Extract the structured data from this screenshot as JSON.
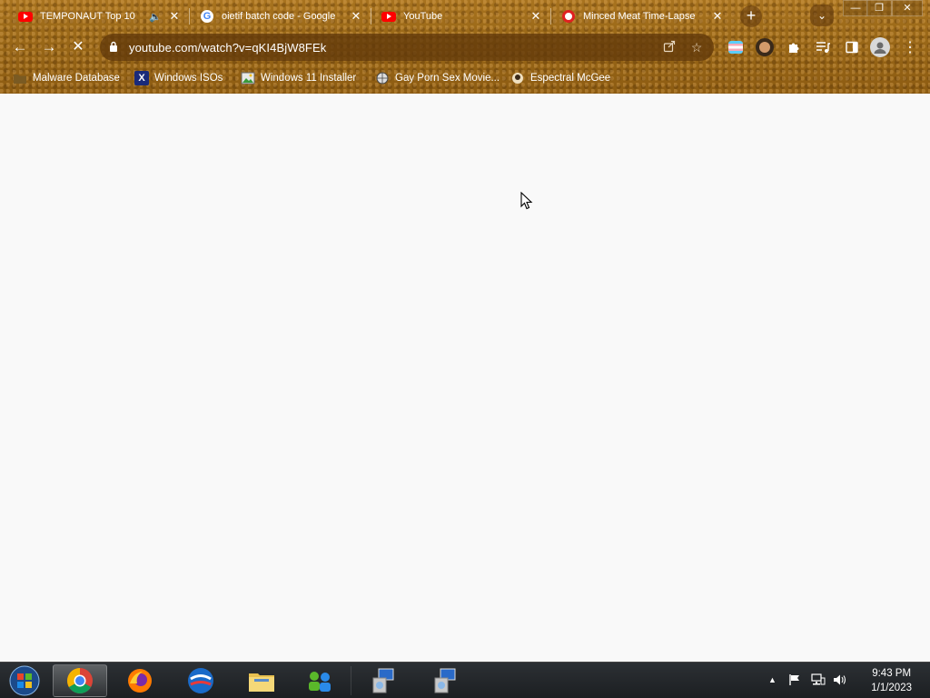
{
  "tabs": [
    {
      "title": "TEMPONAUT Top 10",
      "favicon": "youtube-icon",
      "has_audio": true
    },
    {
      "title": "oietif batch code - Google",
      "favicon": "google-icon",
      "has_audio": false
    },
    {
      "title": "YouTube",
      "favicon": "youtube-icon",
      "has_audio": false
    },
    {
      "title": "Minced Meat Time-Lapse",
      "favicon": "recording-icon",
      "has_audio": false
    }
  ],
  "toolbar": {
    "url": "youtube.com/watch?v=qKI4BjW8FEk"
  },
  "bookmarks": [
    {
      "label": "Malware Database",
      "icon": "folder-icon"
    },
    {
      "label": "Windows ISOs",
      "icon": "x-logo-icon"
    },
    {
      "label": "Windows 11 Installer",
      "icon": "image-icon"
    },
    {
      "label": "Gay Porn Sex Movie...",
      "icon": "globe-icon"
    },
    {
      "label": "Espectral McGee",
      "icon": "avatar-icon"
    }
  ],
  "taskbar": {
    "apps": [
      "start-orb",
      "chrome",
      "firefox",
      "outlook",
      "file-explorer",
      "network-people",
      "setup-installer",
      "setup-installer"
    ]
  },
  "clock": {
    "time": "9:43 PM",
    "date": "1/1/2023"
  },
  "colors": {
    "theme_brown": "#9a6818",
    "page_bg": "#f9f9f9",
    "taskbar_bg": "#1c1f22"
  }
}
